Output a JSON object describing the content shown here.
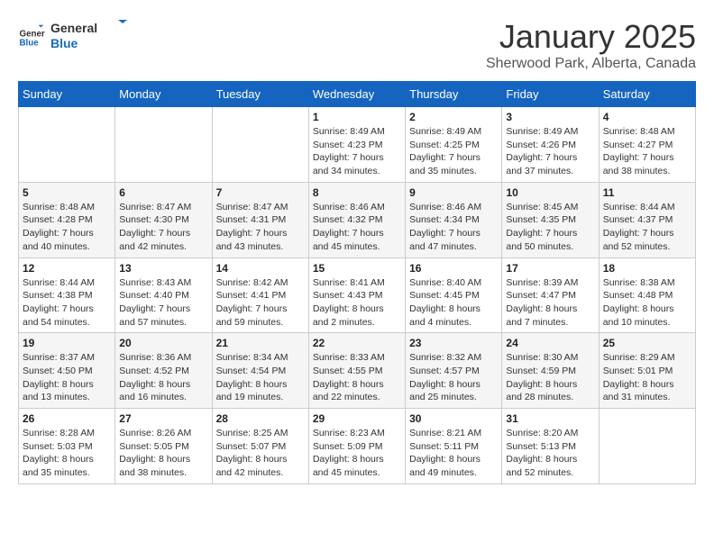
{
  "logo": {
    "general": "General",
    "blue": "Blue"
  },
  "header": {
    "month_year": "January 2025",
    "location": "Sherwood Park, Alberta, Canada"
  },
  "weekdays": [
    "Sunday",
    "Monday",
    "Tuesday",
    "Wednesday",
    "Thursday",
    "Friday",
    "Saturday"
  ],
  "weeks": [
    [
      {
        "day": "",
        "sunrise": "",
        "sunset": "",
        "daylight": ""
      },
      {
        "day": "",
        "sunrise": "",
        "sunset": "",
        "daylight": ""
      },
      {
        "day": "",
        "sunrise": "",
        "sunset": "",
        "daylight": ""
      },
      {
        "day": "1",
        "sunrise": "Sunrise: 8:49 AM",
        "sunset": "Sunset: 4:23 PM",
        "daylight": "Daylight: 7 hours and 34 minutes."
      },
      {
        "day": "2",
        "sunrise": "Sunrise: 8:49 AM",
        "sunset": "Sunset: 4:25 PM",
        "daylight": "Daylight: 7 hours and 35 minutes."
      },
      {
        "day": "3",
        "sunrise": "Sunrise: 8:49 AM",
        "sunset": "Sunset: 4:26 PM",
        "daylight": "Daylight: 7 hours and 37 minutes."
      },
      {
        "day": "4",
        "sunrise": "Sunrise: 8:48 AM",
        "sunset": "Sunset: 4:27 PM",
        "daylight": "Daylight: 7 hours and 38 minutes."
      }
    ],
    [
      {
        "day": "5",
        "sunrise": "Sunrise: 8:48 AM",
        "sunset": "Sunset: 4:28 PM",
        "daylight": "Daylight: 7 hours and 40 minutes."
      },
      {
        "day": "6",
        "sunrise": "Sunrise: 8:47 AM",
        "sunset": "Sunset: 4:30 PM",
        "daylight": "Daylight: 7 hours and 42 minutes."
      },
      {
        "day": "7",
        "sunrise": "Sunrise: 8:47 AM",
        "sunset": "Sunset: 4:31 PM",
        "daylight": "Daylight: 7 hours and 43 minutes."
      },
      {
        "day": "8",
        "sunrise": "Sunrise: 8:46 AM",
        "sunset": "Sunset: 4:32 PM",
        "daylight": "Daylight: 7 hours and 45 minutes."
      },
      {
        "day": "9",
        "sunrise": "Sunrise: 8:46 AM",
        "sunset": "Sunset: 4:34 PM",
        "daylight": "Daylight: 7 hours and 47 minutes."
      },
      {
        "day": "10",
        "sunrise": "Sunrise: 8:45 AM",
        "sunset": "Sunset: 4:35 PM",
        "daylight": "Daylight: 7 hours and 50 minutes."
      },
      {
        "day": "11",
        "sunrise": "Sunrise: 8:44 AM",
        "sunset": "Sunset: 4:37 PM",
        "daylight": "Daylight: 7 hours and 52 minutes."
      }
    ],
    [
      {
        "day": "12",
        "sunrise": "Sunrise: 8:44 AM",
        "sunset": "Sunset: 4:38 PM",
        "daylight": "Daylight: 7 hours and 54 minutes."
      },
      {
        "day": "13",
        "sunrise": "Sunrise: 8:43 AM",
        "sunset": "Sunset: 4:40 PM",
        "daylight": "Daylight: 7 hours and 57 minutes."
      },
      {
        "day": "14",
        "sunrise": "Sunrise: 8:42 AM",
        "sunset": "Sunset: 4:41 PM",
        "daylight": "Daylight: 7 hours and 59 minutes."
      },
      {
        "day": "15",
        "sunrise": "Sunrise: 8:41 AM",
        "sunset": "Sunset: 4:43 PM",
        "daylight": "Daylight: 8 hours and 2 minutes."
      },
      {
        "day": "16",
        "sunrise": "Sunrise: 8:40 AM",
        "sunset": "Sunset: 4:45 PM",
        "daylight": "Daylight: 8 hours and 4 minutes."
      },
      {
        "day": "17",
        "sunrise": "Sunrise: 8:39 AM",
        "sunset": "Sunset: 4:47 PM",
        "daylight": "Daylight: 8 hours and 7 minutes."
      },
      {
        "day": "18",
        "sunrise": "Sunrise: 8:38 AM",
        "sunset": "Sunset: 4:48 PM",
        "daylight": "Daylight: 8 hours and 10 minutes."
      }
    ],
    [
      {
        "day": "19",
        "sunrise": "Sunrise: 8:37 AM",
        "sunset": "Sunset: 4:50 PM",
        "daylight": "Daylight: 8 hours and 13 minutes."
      },
      {
        "day": "20",
        "sunrise": "Sunrise: 8:36 AM",
        "sunset": "Sunset: 4:52 PM",
        "daylight": "Daylight: 8 hours and 16 minutes."
      },
      {
        "day": "21",
        "sunrise": "Sunrise: 8:34 AM",
        "sunset": "Sunset: 4:54 PM",
        "daylight": "Daylight: 8 hours and 19 minutes."
      },
      {
        "day": "22",
        "sunrise": "Sunrise: 8:33 AM",
        "sunset": "Sunset: 4:55 PM",
        "daylight": "Daylight: 8 hours and 22 minutes."
      },
      {
        "day": "23",
        "sunrise": "Sunrise: 8:32 AM",
        "sunset": "Sunset: 4:57 PM",
        "daylight": "Daylight: 8 hours and 25 minutes."
      },
      {
        "day": "24",
        "sunrise": "Sunrise: 8:30 AM",
        "sunset": "Sunset: 4:59 PM",
        "daylight": "Daylight: 8 hours and 28 minutes."
      },
      {
        "day": "25",
        "sunrise": "Sunrise: 8:29 AM",
        "sunset": "Sunset: 5:01 PM",
        "daylight": "Daylight: 8 hours and 31 minutes."
      }
    ],
    [
      {
        "day": "26",
        "sunrise": "Sunrise: 8:28 AM",
        "sunset": "Sunset: 5:03 PM",
        "daylight": "Daylight: 8 hours and 35 minutes."
      },
      {
        "day": "27",
        "sunrise": "Sunrise: 8:26 AM",
        "sunset": "Sunset: 5:05 PM",
        "daylight": "Daylight: 8 hours and 38 minutes."
      },
      {
        "day": "28",
        "sunrise": "Sunrise: 8:25 AM",
        "sunset": "Sunset: 5:07 PM",
        "daylight": "Daylight: 8 hours and 42 minutes."
      },
      {
        "day": "29",
        "sunrise": "Sunrise: 8:23 AM",
        "sunset": "Sunset: 5:09 PM",
        "daylight": "Daylight: 8 hours and 45 minutes."
      },
      {
        "day": "30",
        "sunrise": "Sunrise: 8:21 AM",
        "sunset": "Sunset: 5:11 PM",
        "daylight": "Daylight: 8 hours and 49 minutes."
      },
      {
        "day": "31",
        "sunrise": "Sunrise: 8:20 AM",
        "sunset": "Sunset: 5:13 PM",
        "daylight": "Daylight: 8 hours and 52 minutes."
      },
      {
        "day": "",
        "sunrise": "",
        "sunset": "",
        "daylight": ""
      }
    ]
  ]
}
